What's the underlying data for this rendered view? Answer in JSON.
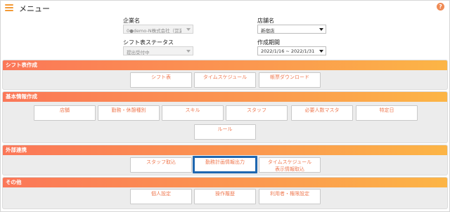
{
  "header": {
    "title": "メニュー",
    "help_icon_text": "?"
  },
  "filters": {
    "company": {
      "label": "企業名",
      "value": "0●demo-N株式会社（営業："
    },
    "store": {
      "label": "店舗名",
      "value": "新宿店"
    },
    "shift_status": {
      "label": "シフト表ステータス",
      "value": "提出受付中"
    },
    "period": {
      "label": "作成期間",
      "value": "2022/1/16 ~ 2022/1/31"
    }
  },
  "sections": {
    "shift": {
      "title": "シフト表作成",
      "buttons": [
        "シフト表",
        "タイムスケジュール",
        "帳票ダウンロード"
      ]
    },
    "basic": {
      "title": "基本情報作成",
      "buttons": [
        "店舗",
        "勤務・休憩種別",
        "スキル",
        "スタッフ",
        "必要人数マスタ",
        "特定日",
        "ルール"
      ]
    },
    "external": {
      "title": "外部連携",
      "buttons": [
        "スタッフ取込",
        "勤務計画情報出力",
        "タイムスケジュール\n表示情報取込"
      ]
    },
    "other": {
      "title": "その他",
      "buttons": [
        "個人設定",
        "操作履歴",
        "利用者・権限設定"
      ]
    }
  },
  "colors": {
    "accent_orange": "#f39a36",
    "button_text": "#ef7a52",
    "focus_border": "#1f67b0"
  }
}
